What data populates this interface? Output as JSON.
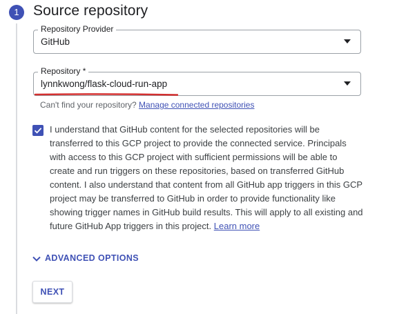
{
  "step": {
    "number": "1",
    "title": "Source repository"
  },
  "provider_field": {
    "label": "Repository Provider",
    "value": "GitHub"
  },
  "repository_field": {
    "label": "Repository *",
    "value": "lynnkwong/flask-cloud-run-app",
    "underline_color": "#d32f2f"
  },
  "helper": {
    "text": "Can't find your repository?",
    "link": "Manage connected repositories"
  },
  "consent": {
    "checked": true,
    "text": "I understand that GitHub content for the selected repositories will be transferred to this GCP project to provide the connected service. Principals with access to this GCP project with sufficient permissions will be able to create and run triggers on these repositories, based on transferred GitHub content. I also understand that content from all GitHub app triggers in this GCP project may be transferred to GitHub in order to provide functionality like showing trigger names in GitHub build results. This will apply to all existing and future GitHub App triggers in this project.",
    "link": "Learn more"
  },
  "advanced_options": {
    "label": "ADVANCED OPTIONS",
    "icon": "chevron-down-icon"
  },
  "next_button": {
    "label": "NEXT"
  },
  "colors": {
    "accent": "#3f51b5",
    "annotation_red": "#d32f2f"
  }
}
